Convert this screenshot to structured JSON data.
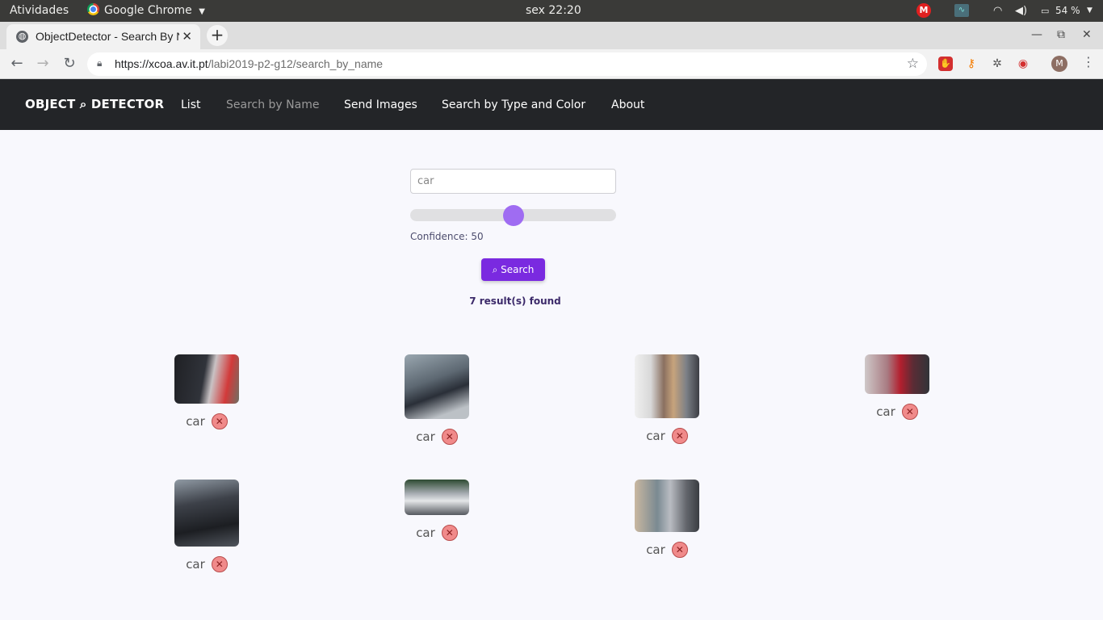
{
  "os_bar": {
    "activities": "Atividades",
    "app_name": "Google Chrome",
    "clock": "sex 22:20",
    "battery": "54 %"
  },
  "browser": {
    "tab_title": "ObjectDetector - Search By Name",
    "url_host": "https://xcoa.av.it.pt",
    "url_path": "/labi2019-p2-g12/search_by_name",
    "profile_initial": "M"
  },
  "site": {
    "brand": "OBJECT ⌕ DETECTOR",
    "nav": [
      "List",
      "Search by Name",
      "Send Images",
      "Search by Type and Color",
      "About"
    ],
    "active_nav": "Search by Name"
  },
  "search": {
    "value": "car",
    "confidence_label": "Confidence: 50",
    "confidence_value": 50,
    "button_label": "⌕ Search",
    "results": "7 result(s) found",
    "accent_color": "#7a2ae0",
    "slider_color": "#9f6cf2"
  },
  "results": [
    {
      "label": "car"
    },
    {
      "label": "car"
    },
    {
      "label": "car"
    },
    {
      "label": "car"
    },
    {
      "label": "car"
    },
    {
      "label": "car"
    },
    {
      "label": "car"
    }
  ]
}
